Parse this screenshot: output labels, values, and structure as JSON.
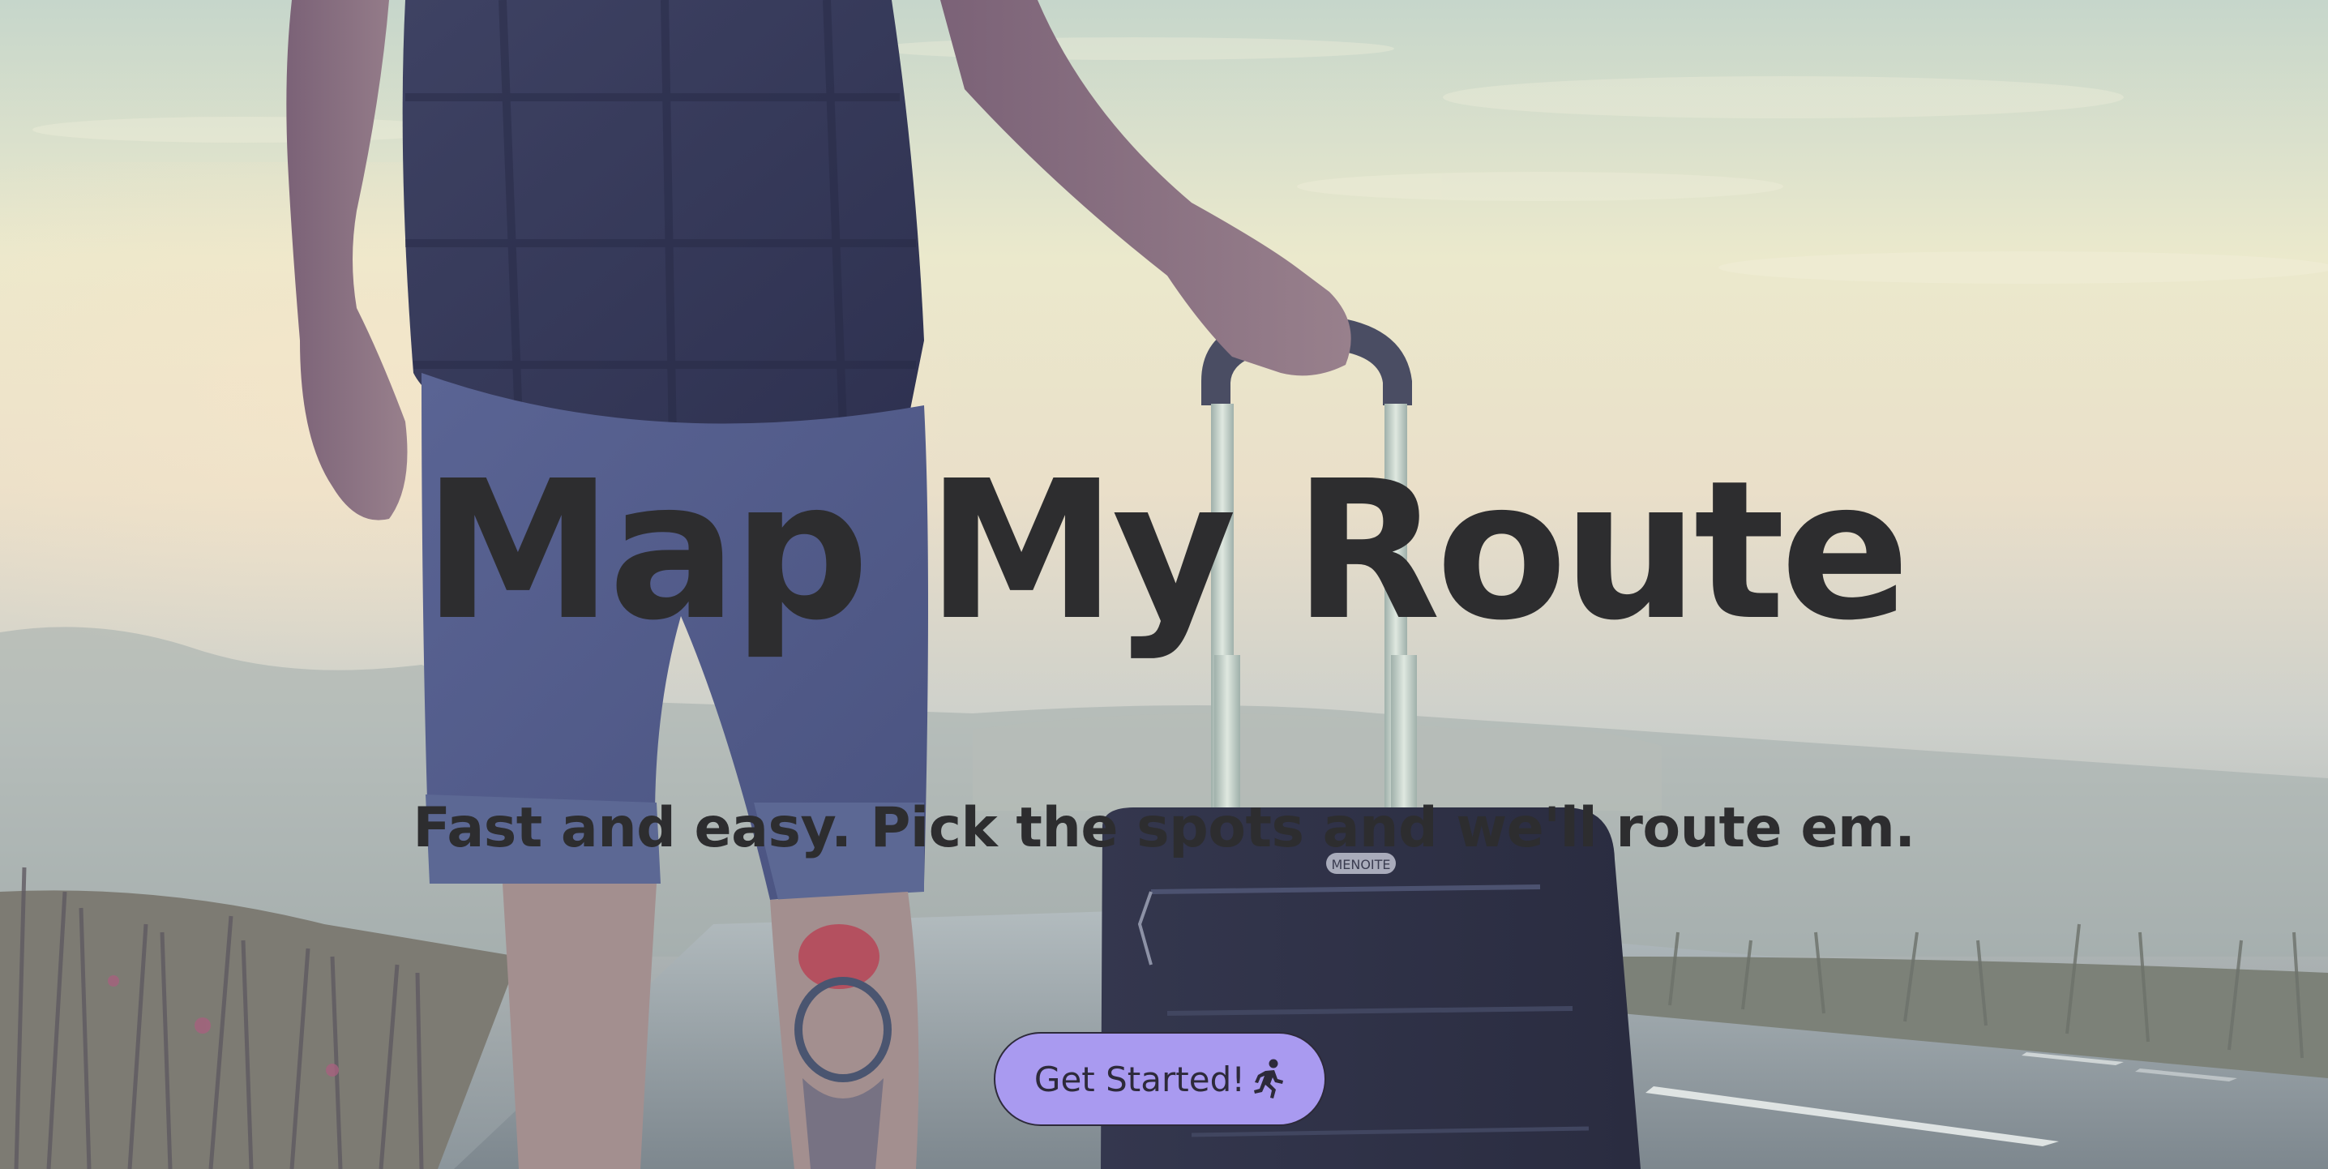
{
  "hero": {
    "title": "Map My Route",
    "subtitle": "Fast and easy. Pick the spots and we'll route em.",
    "cta_label": "Get Started!",
    "cta_icon": "running-person-icon",
    "background_image": "traveler-with-suitcase-on-misty-road",
    "suitcase_brand": "MENOITE"
  },
  "colors": {
    "text": "#2d2d2f",
    "button_bg": "#a99af0",
    "button_border": "#2d2a3a"
  }
}
